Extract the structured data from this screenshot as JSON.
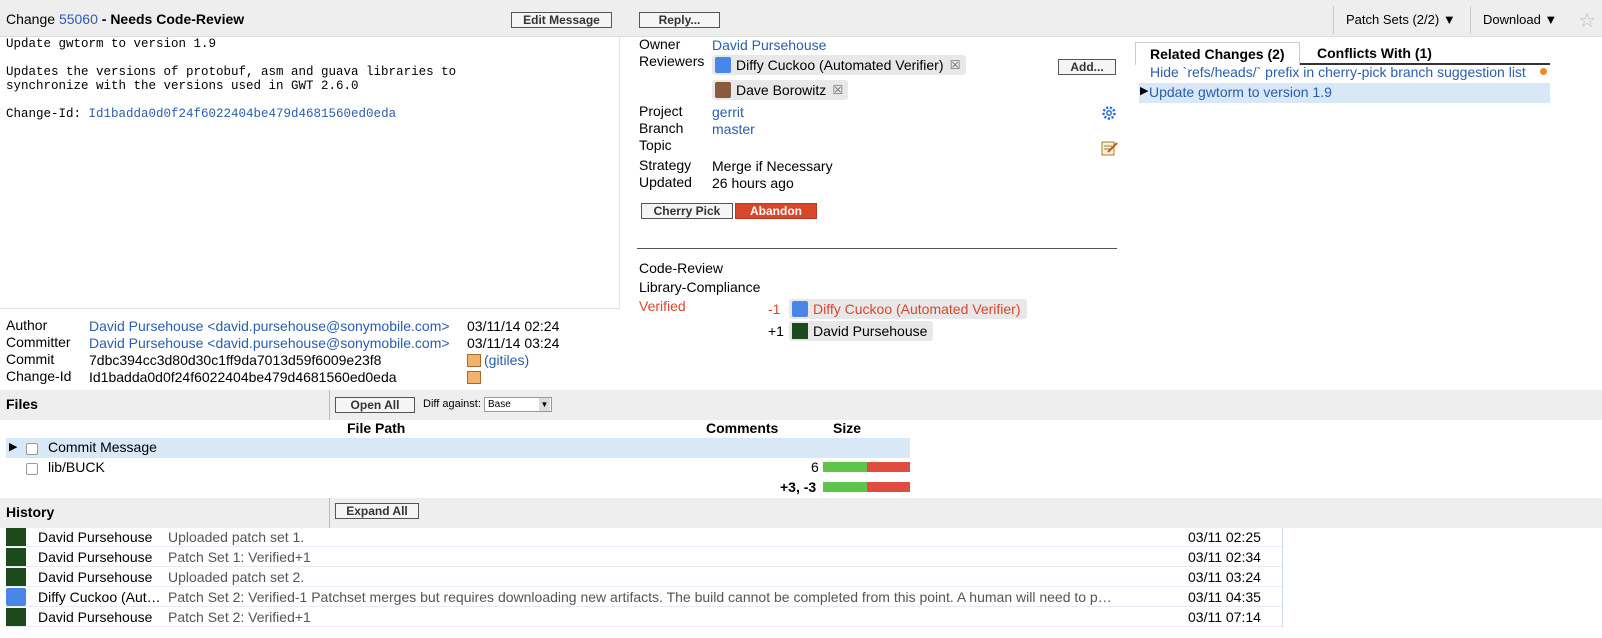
{
  "header": {
    "change_prefix": "Change",
    "change_number": "55060",
    "status": "- Needs Code-Review",
    "edit_message": "Edit Message",
    "reply": "Reply...",
    "patch_sets": "Patch Sets (2/2) ▼",
    "download": "Download ▼",
    "star": "☆"
  },
  "message": {
    "line1": "Update gwtorm to version 1.9",
    "line2": "Updates the versions of protobuf, asm and guava libraries to",
    "line3": "synchronize with the versions used in GWT 2.6.0",
    "changeid_label": "Change-Id: ",
    "changeid_value": "Id1badda0d0f24f6022404be479d4681560ed0eda"
  },
  "info": {
    "owner_label": "Owner",
    "owner": "David Pursehouse",
    "reviewers_label": "Reviewers",
    "reviewer1": "Diffy Cuckoo (Automated Verifier)",
    "reviewer2": "Dave Borowitz",
    "add": "Add...",
    "project_label": "Project",
    "project": "gerrit",
    "branch_label": "Branch",
    "branch": "master",
    "topic_label": "Topic",
    "strategy_label": "Strategy",
    "strategy": "Merge if Necessary",
    "updated_label": "Updated",
    "updated": "26 hours ago",
    "cherry_pick": "Cherry Pick",
    "abandon": "Abandon"
  },
  "labels": {
    "code_review": "Code-Review",
    "library_compliance": "Library-Compliance",
    "verified": "Verified",
    "vote1_score": "-1",
    "vote1_name": "Diffy Cuckoo (Automated Verifier)",
    "vote2_score": "+1",
    "vote2_name": "David Pursehouse"
  },
  "related": {
    "tab1": "Related Changes (2)",
    "tab2": "Conflicts With (1)",
    "item1": "Hide `refs/heads/` prefix in cherry-pick branch suggestion list",
    "item2": "Update gwtorm to version 1.9"
  },
  "commit": {
    "author_label": "Author",
    "author": "David Pursehouse <david.pursehouse@sonymobile.com>",
    "author_date": "03/11/14 02:24",
    "committer_label": "Committer",
    "committer": "David Pursehouse <david.pursehouse@sonymobile.com>",
    "committer_date": "03/11/14 03:24",
    "commit_label": "Commit",
    "commit": "7dbc394cc3d80d30c1ff9da7013d59f6009e23f8",
    "gitiles": "(gitiles)",
    "changeid_label": "Change-Id",
    "changeid": "Id1badda0d0f24f6022404be479d4681560ed0eda"
  },
  "files": {
    "title": "Files",
    "open_all": "Open All",
    "diff_against": "Diff against:",
    "diff_base": "Base",
    "col_path": "File Path",
    "col_comments": "Comments",
    "col_size": "Size",
    "rows": [
      {
        "path": "Commit Message",
        "size": ""
      },
      {
        "path": "lib/BUCK",
        "size": "6"
      }
    ],
    "total": "+3, -3",
    "size_bars": [
      {
        "added_fraction": 0.5
      },
      {
        "added_fraction": 0.5
      }
    ]
  },
  "history": {
    "title": "History",
    "expand_all": "Expand All",
    "rows": [
      {
        "name": "David Pursehouse",
        "msg": "Uploaded patch set 1.",
        "date": "03/11 02:25"
      },
      {
        "name": "David Pursehouse",
        "msg": "Patch Set 1: Verified+1",
        "date": "03/11 02:34"
      },
      {
        "name": "David Pursehouse",
        "msg": "Uploaded patch set 2.",
        "date": "03/11 03:24"
      },
      {
        "name": "Diffy Cuckoo (Aut…",
        "msg": "Patch Set 2: Verified-1 Patchset merges but requires downloading new artifacts. The build cannot be completed from this point. A human will need to p…",
        "date": "03/11 04:35"
      },
      {
        "name": "David Pursehouse",
        "msg": "Patch Set 2: Verified+1",
        "date": "03/11 07:14"
      }
    ]
  },
  "colors": {
    "link": "#2a5db0",
    "abandon": "#d9472b",
    "negative": "#d9472b",
    "selected_row": "#d8e8f6",
    "bar_added": "#5fc44a",
    "bar_removed": "#e04c40"
  }
}
